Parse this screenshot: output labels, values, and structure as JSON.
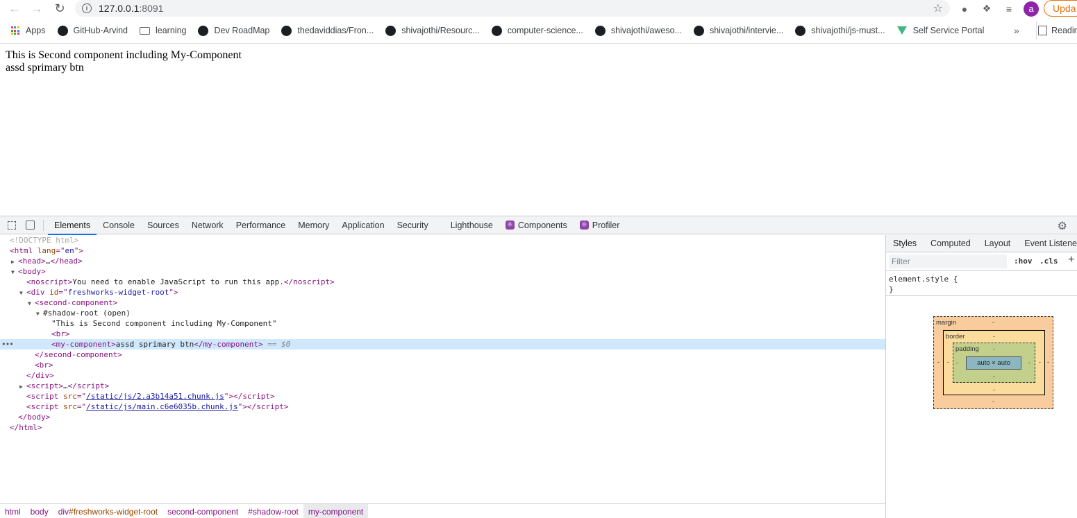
{
  "browser": {
    "url_host": "127.0.0.1",
    "url_port": ":8091",
    "avatar_letter": "a",
    "update_label": "Upda"
  },
  "bookmarks": {
    "items": [
      {
        "label": "Apps",
        "icon": "apps-grid-icon"
      },
      {
        "label": "GitHub-Arvind",
        "icon": "github-icon"
      },
      {
        "label": "learning",
        "icon": "folder-icon"
      },
      {
        "label": "Dev RoadMap",
        "icon": "github-icon"
      },
      {
        "label": "thedaviddias/Fron...",
        "icon": "github-icon"
      },
      {
        "label": "shivajothi/Resourc...",
        "icon": "github-icon"
      },
      {
        "label": "computer-science...",
        "icon": "github-icon"
      },
      {
        "label": "shivajothi/aweso...",
        "icon": "github-icon"
      },
      {
        "label": "shivajothi/intervie...",
        "icon": "github-icon"
      },
      {
        "label": "shivajothi/js-must...",
        "icon": "github-icon"
      },
      {
        "label": "Self Service Portal",
        "icon": "vue-icon"
      }
    ],
    "more": "»",
    "reading_list": "Readin"
  },
  "page": {
    "line1": "This is Second component including My-Component",
    "line2": "assd sprimary btn"
  },
  "devtools": {
    "tabs": [
      "Elements",
      "Console",
      "Sources",
      "Network",
      "Performance",
      "Memory",
      "Application",
      "Security",
      "Lighthouse",
      "Components",
      "Profiler"
    ],
    "active_tab": "Elements",
    "tree": {
      "doctype": "<!DOCTYPE html>",
      "html_lang": "en",
      "noscript_text": "You need to enable JavaScript to run this app.",
      "div_id": "freshworks-widget-root",
      "shadow_root": "#shadow-root (open)",
      "text_node": "\"This is Second component including My-Component\"",
      "my_component_text": "assd sprimary btn",
      "selected_suffix": "== $0",
      "script1_src": "/static/js/2.a3b14a51.chunk.js",
      "script2_src": "/static/js/main.c6e6035b.chunk.js"
    },
    "breadcrumbs": [
      "html",
      "body",
      "div#freshworks-widget-root",
      "second-component",
      "#shadow-root",
      "my-component"
    ],
    "styles": {
      "tabs": [
        "Styles",
        "Computed",
        "Layout",
        "Event Listeners"
      ],
      "filter_placeholder": "Filter",
      "hov": ":hov",
      "cls": ".cls",
      "rule_selector": "element.style {",
      "rule_close": "}",
      "box": {
        "margin_label": "margin",
        "border_label": "border",
        "padding_label": "padding",
        "content_label": "auto × auto",
        "dash": "-"
      }
    }
  }
}
